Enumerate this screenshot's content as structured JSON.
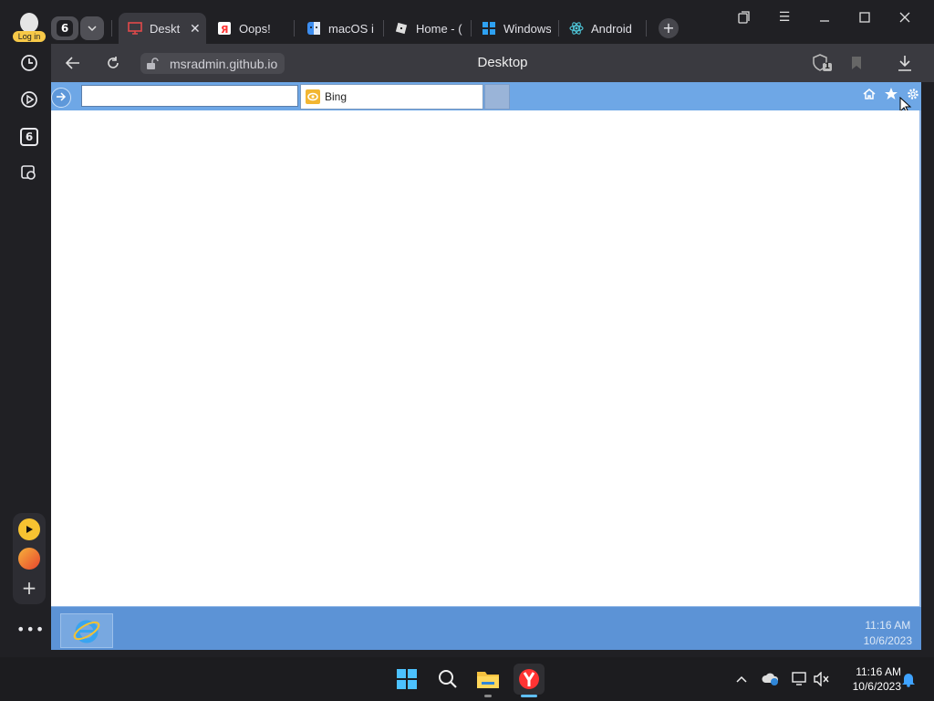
{
  "sidebar": {
    "login_label": "Log in",
    "tabs_count": "6"
  },
  "tabstrip": {
    "counter": "6",
    "tabs": [
      {
        "label": "Deskt",
        "icon": "monitor-icon",
        "active": true
      },
      {
        "label": "Oops!",
        "icon": "yandex-icon"
      },
      {
        "label": "macOS i",
        "icon": "finder-icon"
      },
      {
        "label": "Home - (",
        "icon": "roblox-icon"
      },
      {
        "label": "Windows",
        "icon": "windows-icon"
      },
      {
        "label": "Android",
        "icon": "react-icon"
      }
    ]
  },
  "addressbar": {
    "url": "msradmin.github.io",
    "page_title": "Desktop",
    "protect_count": "1"
  },
  "ie": {
    "address_value": "",
    "search_engine": "Bing",
    "clock_time": "11:16 AM",
    "clock_date": "10/6/2023"
  },
  "taskbar": {
    "clock_time": "11:16 AM",
    "clock_date": "10/6/2023"
  },
  "colors": {
    "ie_blue": "#6ea7e6",
    "ie_taskbar": "#5c93d6",
    "yandex_red": "#ff3333",
    "browser_bg": "#202024"
  }
}
